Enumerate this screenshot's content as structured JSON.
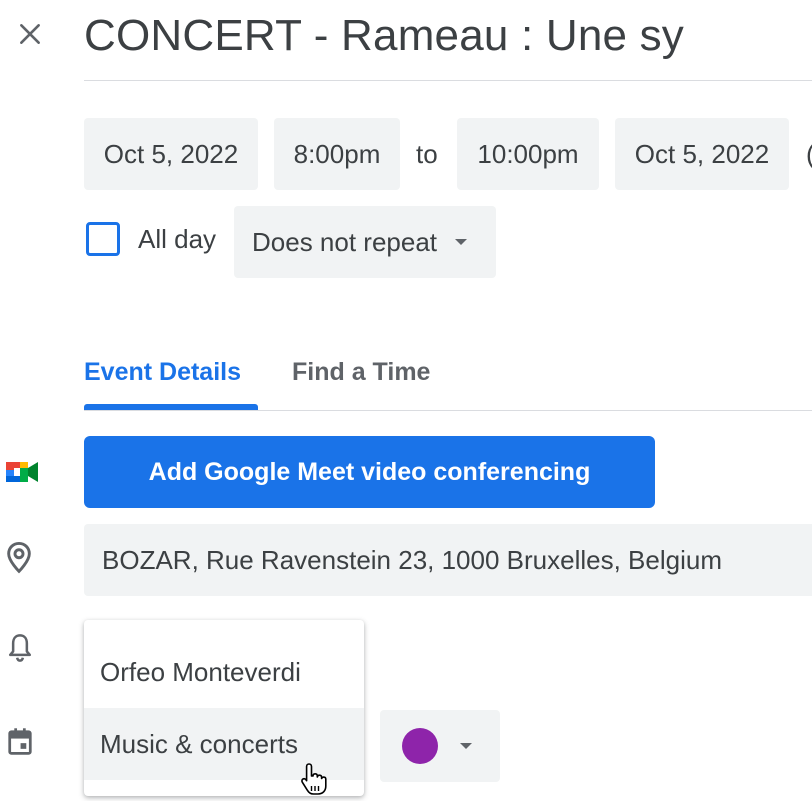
{
  "event": {
    "title": "CONCERT - Rameau : Une sy",
    "start_date": "Oct 5, 2022",
    "start_time": "8:00pm",
    "to_label": "to",
    "end_time": "10:00pm",
    "end_date": "Oct 5, 2022",
    "trailing_partial": "(",
    "all_day_label": "All day",
    "all_day_checked": false,
    "repeat": "Does not repeat"
  },
  "tabs": [
    {
      "label": "Event Details",
      "active": true
    },
    {
      "label": "Find a Time",
      "active": false
    }
  ],
  "meet_button_label": "Add Google Meet video conferencing",
  "location": "BOZAR, Rue Ravenstein 23, 1000 Bruxelles, Belgium",
  "calendar_menu": {
    "items": [
      "Orfeo Monteverdi",
      "Music & concerts"
    ],
    "hovered_index": 1
  },
  "event_color": "#8e24aa",
  "icons": {
    "close": "close-icon",
    "meet": "google-meet-icon",
    "location": "location-pin-icon",
    "notification": "bell-icon",
    "calendar": "calendar-icon",
    "cursor": "hand-pointer-cursor"
  },
  "colors": {
    "accent": "#1a73e8",
    "chip_bg": "#f1f3f4",
    "text": "#3c4043"
  }
}
